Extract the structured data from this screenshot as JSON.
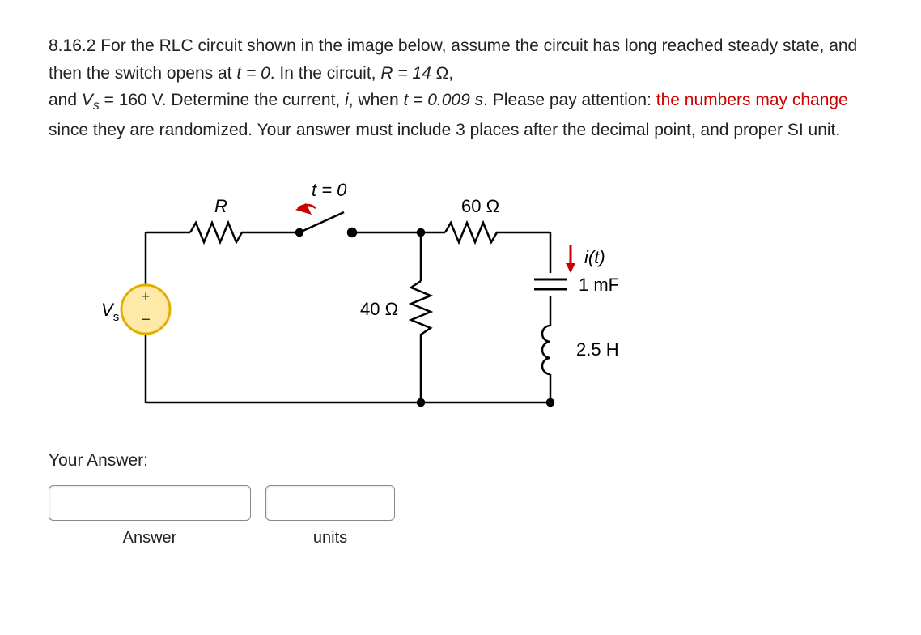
{
  "problem": {
    "number": "8.16.2",
    "prefix": "For the RLC circuit shown in the image below, assume the circuit has long reached steady state, and then the switch opens at ",
    "t_eq": "t = 0",
    "mid1": ". In the circuit, ",
    "R_eq": "R = 14",
    "ohm": " Ω,",
    "mid2": "and ",
    "Vs_eq": " = 160 V. Determine the current, ",
    "i_sym": "i",
    "mid3": ", when ",
    "t_val": "t = 0.009 s",
    "mid4": ". Please pay attention: ",
    "red_part": "the numbers may change",
    "tail": " since they are randomized. Your answer must include 3 places after the decimal point, and proper SI unit."
  },
  "circuit": {
    "switch_label": "t = 0",
    "R_label": "R",
    "R60": "60 Ω",
    "R40": "40 Ω",
    "i_label": "i(t)",
    "C_label": "1 mF",
    "L_label": "2.5 H",
    "Vs_label": "V"
  },
  "answer": {
    "label": "Your Answer:",
    "answer_caption": "Answer",
    "units_caption": "units",
    "answer_value": "",
    "units_value": ""
  }
}
